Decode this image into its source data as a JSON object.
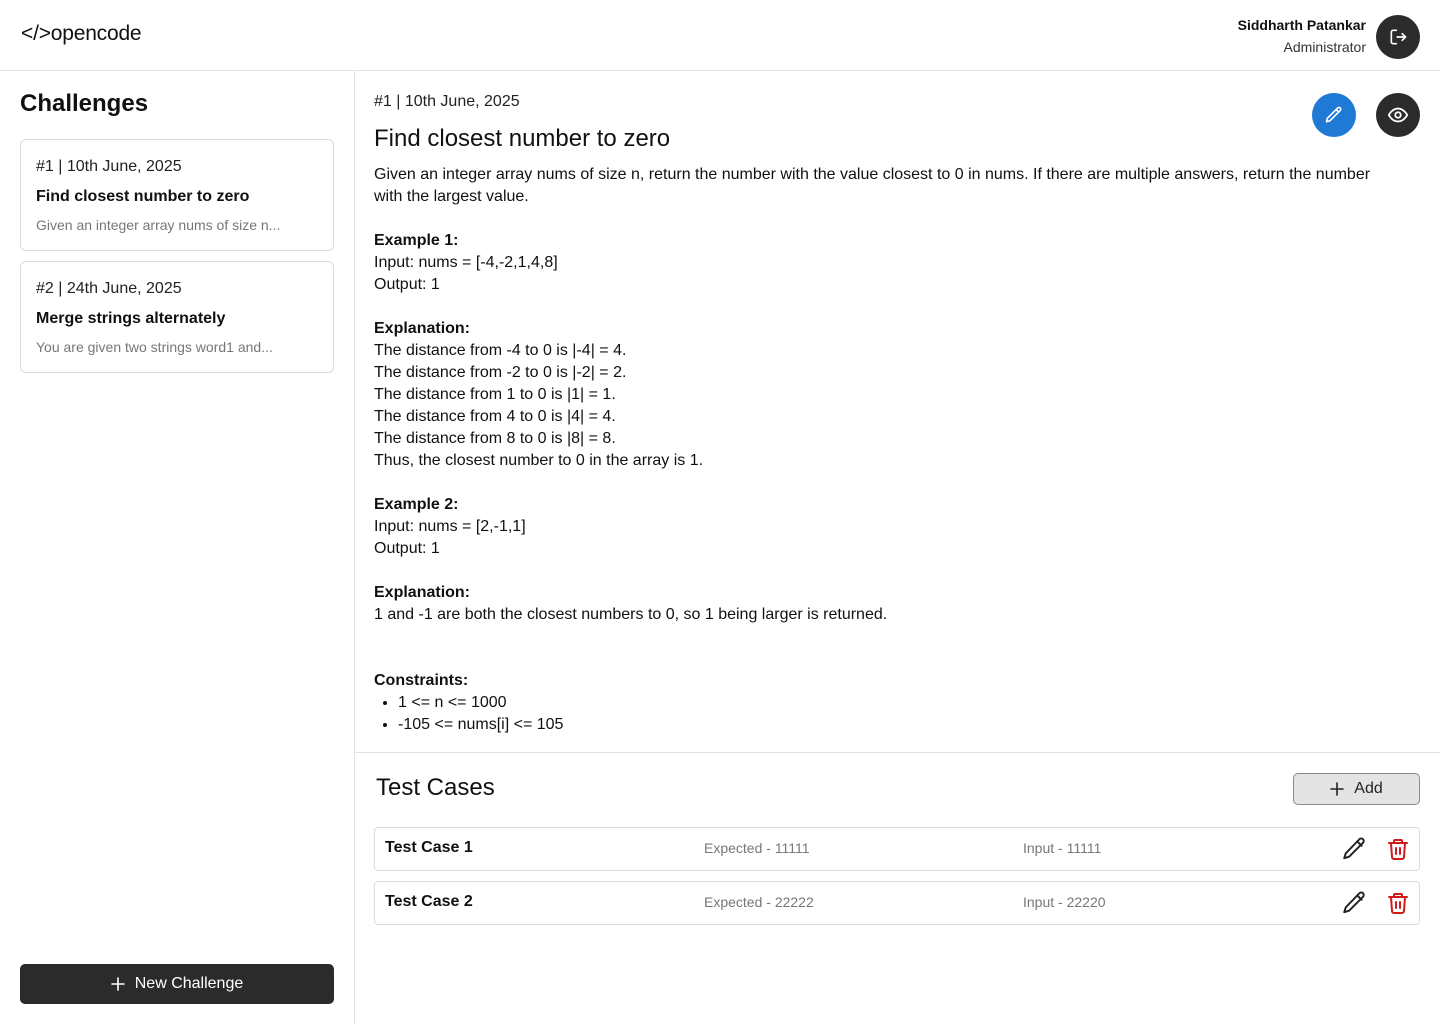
{
  "header": {
    "logo": "</>opencode",
    "user_name": "Siddharth Patankar",
    "user_role": "Administrator"
  },
  "sidebar": {
    "title": "Challenges",
    "challenges": [
      {
        "meta": "#1 | 10th June, 2025",
        "title": "Find closest number to zero",
        "desc": "Given an integer array nums of size n..."
      },
      {
        "meta": "#2 | 24th June, 2025",
        "title": "Merge strings alternately",
        "desc": "You are given two strings word1 and..."
      }
    ],
    "new_button_label": "New Challenge"
  },
  "problem": {
    "meta": "#1 | 10th June, 2025",
    "title": "Find closest number to zero",
    "description": "Given an integer array nums of size n, return the number with the value closest to 0 in nums. If there are multiple answers, return the number with the largest value.",
    "example1_heading": "Example 1:",
    "example1_input": "Input: nums = [-4,-2,1,4,8]",
    "example1_output": "Output: 1",
    "explanation1_heading": "Explanation:",
    "explanation1_lines": [
      "The distance from -4 to 0 is |-4| = 4.",
      "The distance from -2 to 0 is |-2| = 2.",
      "The distance from 1 to 0 is |1| = 1.",
      "The distance from 4 to 0 is |4| = 4.",
      "The distance from 8 to 0 is |8| = 8.",
      "Thus, the closest number to 0 in the array is 1."
    ],
    "example2_heading": "Example 2:",
    "example2_input": "Input: nums = [2,-1,1]",
    "example2_output": "Output: 1",
    "explanation2_heading": "Explanation:",
    "explanation2_text": "1 and -1 are both the closest numbers to 0, so 1 being larger is returned.",
    "constraints_heading": "Constraints:",
    "constraints": [
      "1 <= n <= 1000",
      "-105 <= nums[i] <= 105"
    ]
  },
  "test_cases": {
    "title": "Test Cases",
    "add_label": "Add",
    "items": [
      {
        "name": "Test Case 1",
        "expected": "Expected - 11111",
        "input": "Input - 11111"
      },
      {
        "name": "Test Case 2",
        "expected": "Expected - 22222",
        "input": "Input - 22220"
      }
    ]
  },
  "colors": {
    "dark": "#2b2b2b",
    "accent_blue": "#1f7ad6",
    "delete_red": "#d11a1a",
    "border": "#dcdcdc"
  },
  "icons": {
    "logout": "logout-icon",
    "edit": "pencil-icon",
    "view": "eye-icon",
    "plus": "plus-icon",
    "delete": "trash-icon"
  }
}
